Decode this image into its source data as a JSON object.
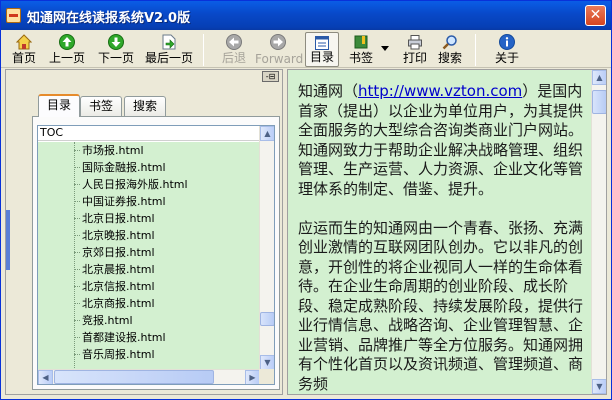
{
  "window": {
    "title": "知通网在线读报系统V2.0版",
    "close_label": "✕"
  },
  "toolbar": {
    "home": "首页",
    "prev": "上一页",
    "next": "下一页",
    "last": "最后一页",
    "back": "后退",
    "forward": "Forward",
    "toc": "目录",
    "bookmark": "书签",
    "print": "打印",
    "search": "搜索",
    "about": "关于"
  },
  "sidebar": {
    "pin_label": "-⊟",
    "tabs": [
      "目录",
      "书签",
      "搜索"
    ],
    "tree_header": "TOC",
    "items": [
      "市场报.html",
      "国际金融报.html",
      "人民日报海外版.html",
      "中国证券报.html",
      "北京日报.html",
      "北京晚报.html",
      "京郊日报.html",
      "北京晨报.html",
      "北京信报.html",
      "北京商报.html",
      "竞报.html",
      "首都建设报.html",
      "音乐周报.html"
    ]
  },
  "content": {
    "para1_prefix": "知通网（",
    "para1_link": "http://www.vzton.com",
    "para1_suffix": "）是国内首家（提出）以企业为单位用户，为其提供全面服务的大型综合咨询类商业门户网站。",
    "para2": "知通网致力于帮助企业解决战略管理、组织管理、生产运营、人力资源、企业文化等管理体系的制定、借鉴、提升。",
    "para3": "应运而生的知通网由一个青春、张扬、充满创业激情的互联网团队创办。它以非凡的创意，开创性的将企业视同人一样的生命体看待。在企业生命周期的创业阶段、成长阶段、稳定成熟阶段、持续发展阶段，提供行业行情信息、战略咨询、企业管理智慧、企业营销、品牌推广等全方位服务。知通网拥有个性化首页以及资讯频道、管理频道、商务频"
  },
  "colors": {
    "title_bar": "#0848c8",
    "pane_bg": "#d3f0d0",
    "link": "#0000cc"
  }
}
